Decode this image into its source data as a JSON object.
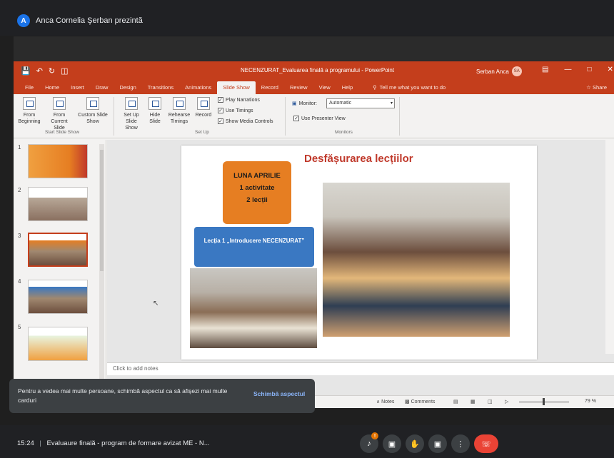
{
  "meet": {
    "presenter_initial": "A",
    "presenter_label": "Anca Cornelia Şerban prezintă",
    "time": "15:24",
    "separator": "|",
    "meeting_title": "Evaluaure finală - program de formare avizat ME - N..."
  },
  "ppt": {
    "doc_title": "NECENZURAT_Evaluarea finală a programului - PowerPoint",
    "user_name": "Serban Anca",
    "user_initials": "SA",
    "tabs": [
      "File",
      "Home",
      "Insert",
      "Draw",
      "Design",
      "Transitions",
      "Animations",
      "Slide Show",
      "Record",
      "Review",
      "View",
      "Help"
    ],
    "active_tab": "Slide Show",
    "tell_me": "Tell me what you want to do",
    "share": "Share",
    "ribbon": {
      "from_beginning": "From Beginning",
      "from_current": "From Current Slide",
      "custom_show": "Custom Slide Show",
      "group_start": "Start Slide Show",
      "setup_show": "Set Up Slide Show",
      "hide_slide": "Hide Slide",
      "rehearse": "Rehearse Timings",
      "record": "Record",
      "play_narrations": "Play Narrations",
      "use_timings": "Use Timings",
      "show_media": "Show Media Controls",
      "group_setup": "Set Up",
      "monitor_label": "Monitor:",
      "monitor_value": "Automatic",
      "presenter_view": "Use Presenter View",
      "group_monitors": "Monitors"
    },
    "thumb_numbers": [
      "1",
      "2",
      "3",
      "4",
      "5"
    ],
    "slide": {
      "title": "Desfășurarea lecțiilor",
      "orange_line1": "LUNA APRILIE",
      "orange_line2": "1 activitate",
      "orange_line3": "2 lecții",
      "blue_box": "Lecția 1 „Introducere NECENZURAT”"
    },
    "notes_placeholder": "Click to add notes",
    "status": {
      "notes": "Notes",
      "comments": "Comments",
      "zoom": "79 %"
    }
  },
  "toast": {
    "message": "Pentru a vedea mai multe persoane, schimbă aspectul ca să afișezi mai multe carduri",
    "action": "Schimbă aspectul"
  },
  "controls": {
    "badge": "!"
  }
}
